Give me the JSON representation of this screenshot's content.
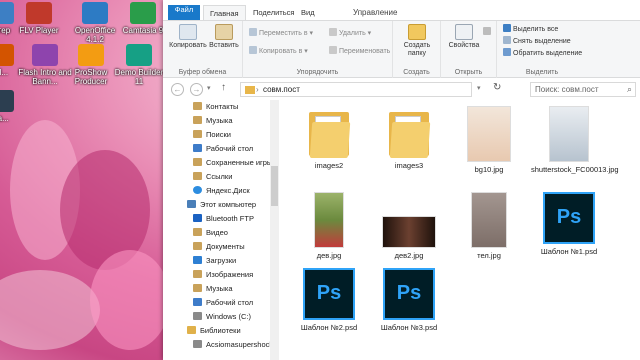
{
  "desktop": {
    "icons": [
      {
        "label": "FLV Player",
        "color": "#c0392b"
      },
      {
        "label": "OpenOffice 4.1.2",
        "color": "#2d7bc4"
      },
      {
        "label": "Camtasia 9",
        "color": "#2a9d4a"
      },
      {
        "label": "Flash Intro and Bann...",
        "color": "#8e44ad"
      },
      {
        "label": "ProShow Producer",
        "color": "#f39c12"
      },
      {
        "label": "Demo Builder 11",
        "color": "#16a085"
      },
      {
        "label": "ютер",
        "color": "#3d7fc4"
      },
      {
        "label": "Cl...",
        "color": "#d35400"
      },
      {
        "label": "ра...",
        "color": "#2c3e50"
      }
    ]
  },
  "window": {
    "contextual_group": "Управление",
    "tabs": [
      "Файл",
      "Главная",
      "Поделиться",
      "Вид"
    ],
    "ribbon": {
      "clipboard": {
        "name": "Буфер обмена",
        "copy": "Копировать",
        "paste": "Вставить"
      },
      "organize": {
        "name": "Упорядочить",
        "move_to": "Переместить в",
        "copy_to": "Копировать в",
        "delete": "Удалить",
        "rename": "Переименовать"
      },
      "new": {
        "name": "Создать",
        "new_folder": "Создать папку"
      },
      "open": {
        "name": "Открыть",
        "properties": "Свойства"
      },
      "select": {
        "name": "Выделить",
        "select_all": "Выделить все",
        "select_none": "Снять выделение",
        "invert": "Обратить выделение"
      }
    },
    "address": {
      "path": "совм.пост",
      "search_placeholder": "Поиск: совм.пост"
    },
    "nav_items": [
      {
        "label": "Контакты",
        "color": "#c9a25a"
      },
      {
        "label": "Музыка",
        "color": "#c9a25a"
      },
      {
        "label": "Поиски",
        "color": "#c9a25a"
      },
      {
        "label": "Рабочий стол",
        "color": "#3e7cc9"
      },
      {
        "label": "Сохраненные игры",
        "color": "#c9a25a"
      },
      {
        "label": "Ссылки",
        "color": "#c9a25a"
      },
      {
        "label": "Яндекс.Диск",
        "color": "#2d8de0"
      },
      {
        "label": "Этот компьютер",
        "color": "#4a7fb8"
      },
      {
        "label": "Bluetooth FTP",
        "color": "#1b62c2"
      },
      {
        "label": "Видео",
        "color": "#c9a25a"
      },
      {
        "label": "Документы",
        "color": "#c9a25a"
      },
      {
        "label": "Загрузки",
        "color": "#2d7fd3"
      },
      {
        "label": "Изображения",
        "color": "#c9a25a"
      },
      {
        "label": "Музыка",
        "color": "#c9a25a"
      },
      {
        "label": "Рабочий стол",
        "color": "#3e7cc9"
      },
      {
        "label": "Windows (C:)",
        "color": "#8a8a8a"
      },
      {
        "label": "Библиотеки",
        "color": "#e0b14a"
      },
      {
        "label": "Acsiomasupershock",
        "color": "#8a8a8a"
      }
    ],
    "files": [
      {
        "name": "images2",
        "kind": "folder"
      },
      {
        "name": "images3",
        "kind": "folder"
      },
      {
        "name": "bg10.jpg",
        "kind": "photo",
        "color": "#e8c9b0"
      },
      {
        "name": "shutterstock_FC00013.jpg",
        "kind": "photo",
        "color": "#b7c3cf"
      },
      {
        "name": "дев.jpg",
        "kind": "photo",
        "color": "#6b8a3e"
      },
      {
        "name": "дев2.jpg",
        "kind": "photo",
        "color": "#3a2418"
      },
      {
        "name": "тел.jpg",
        "kind": "photo",
        "color": "#7d6e68"
      },
      {
        "name": "Шаблон №1.psd",
        "kind": "psd"
      },
      {
        "name": "Шаблон №2.psd",
        "kind": "psd"
      },
      {
        "name": "Шаблон №3.psd",
        "kind": "psd"
      }
    ],
    "psd_glyph": "Ps"
  }
}
